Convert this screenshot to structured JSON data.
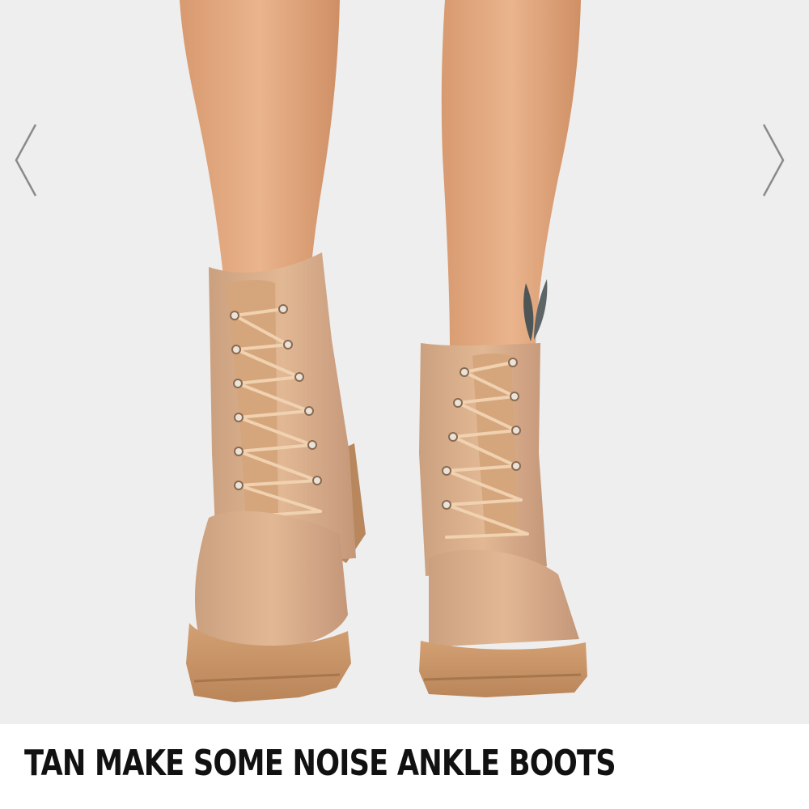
{
  "product": {
    "title": "TAN MAKE SOME NOISE ANKLE BOOTS"
  },
  "gallery": {
    "prev_icon": "chevron-left-icon",
    "next_icon": "chevron-right-icon"
  },
  "colors": {
    "background": "#eeeeee",
    "suede_tan": "#d9ab86",
    "sole": "#c9956a",
    "skin": "#e3a77f",
    "title_text": "#111111",
    "arrow": "#8a8a8a"
  }
}
